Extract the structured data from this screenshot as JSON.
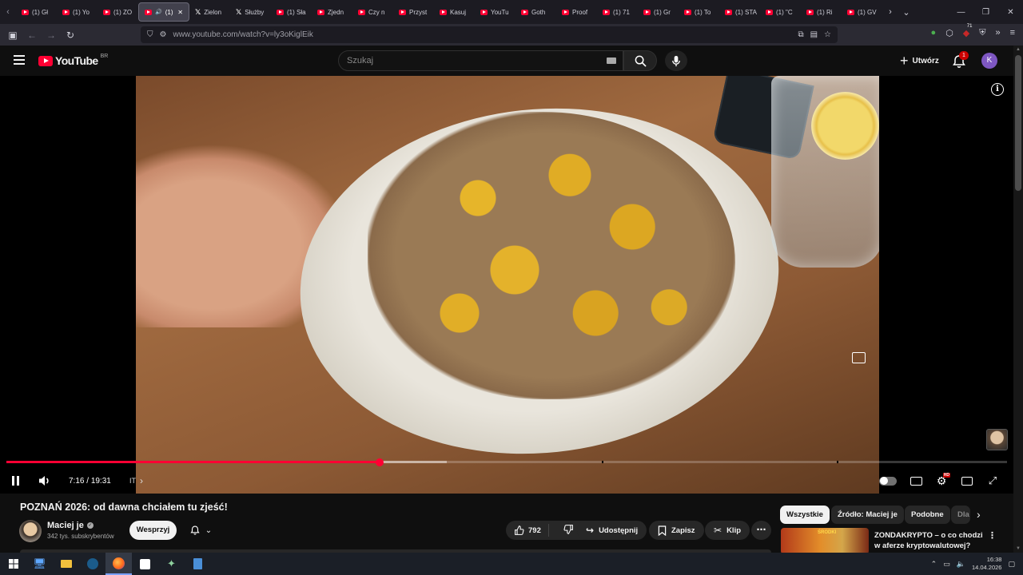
{
  "browser": {
    "tabs": [
      {
        "label": "(1) Gł",
        "icon": "youtube-icon"
      },
      {
        "label": "(1) Yo",
        "icon": "youtube-icon"
      },
      {
        "label": "(1) ZO",
        "icon": "youtube-icon"
      },
      {
        "label": "(1)",
        "icon": "youtube-icon",
        "active": true
      },
      {
        "label": "Zielon",
        "icon": "x-icon"
      },
      {
        "label": "Służby",
        "icon": "x-icon"
      },
      {
        "label": "(1) Sła",
        "icon": "youtube-icon"
      },
      {
        "label": "Zjedn",
        "icon": "youtube-icon"
      },
      {
        "label": "Czy n",
        "icon": "youtube-icon"
      },
      {
        "label": "Przyst",
        "icon": "youtube-icon"
      },
      {
        "label": "Kasuj",
        "icon": "youtube-icon"
      },
      {
        "label": "YouTu",
        "icon": "youtube-icon"
      },
      {
        "label": "Goth",
        "icon": "youtube-icon"
      },
      {
        "label": "Proof",
        "icon": "youtube-icon"
      },
      {
        "label": "(1) 71",
        "icon": "youtube-icon"
      },
      {
        "label": "(1) Gr",
        "icon": "youtube-icon"
      },
      {
        "label": "(1) To",
        "icon": "youtube-icon"
      },
      {
        "label": "(1) STA",
        "icon": "youtube-icon"
      },
      {
        "label": "(1) \"C",
        "icon": "youtube-icon"
      },
      {
        "label": "(1) Ri",
        "icon": "youtube-icon"
      },
      {
        "label": "(1) GV",
        "icon": "youtube-icon"
      }
    ],
    "url": "www.youtube.com/watch?v=ly3oKiglEik",
    "ext_badge": "71"
  },
  "youtube": {
    "logo_text": "YouTube",
    "logo_region": "BR",
    "search_placeholder": "Szukaj",
    "create_label": "Utwórz",
    "notifications_count": "1",
    "avatar_letter": "K"
  },
  "player": {
    "time_current": "7:16",
    "time_sep": " / ",
    "time_total": "19:31",
    "progress": 0.3727,
    "buffered": 0.44,
    "chapter_label": "IT",
    "chapters": [
      0.595,
      0.83
    ]
  },
  "video": {
    "title": "POZNAŃ 2026: od dawna chciałem tu zjeść!",
    "channel_name": "Maciej je",
    "subscribers": "342 tys. subskrybentów",
    "support_label": "Wesprzyj",
    "likes": "792",
    "share_label": "Udostępnij",
    "save_label": "Zapisz",
    "clip_label": "Klip"
  },
  "sidebar": {
    "chips": [
      "Wszystkie",
      "Źródło: Maciej je",
      "Podobne",
      "Dla"
    ],
    "recommendation": {
      "title": "ZONDAKRYPTO – o co chodzi w aferze kryptowalutowej?",
      "thumb_text": "ŚRODKI"
    }
  },
  "taskbar": {
    "time": "16:38",
    "date": "14.04.2026"
  },
  "colors": {
    "accent": "#ff0033",
    "background": "#0f0f0f",
    "chip": "#272727"
  }
}
